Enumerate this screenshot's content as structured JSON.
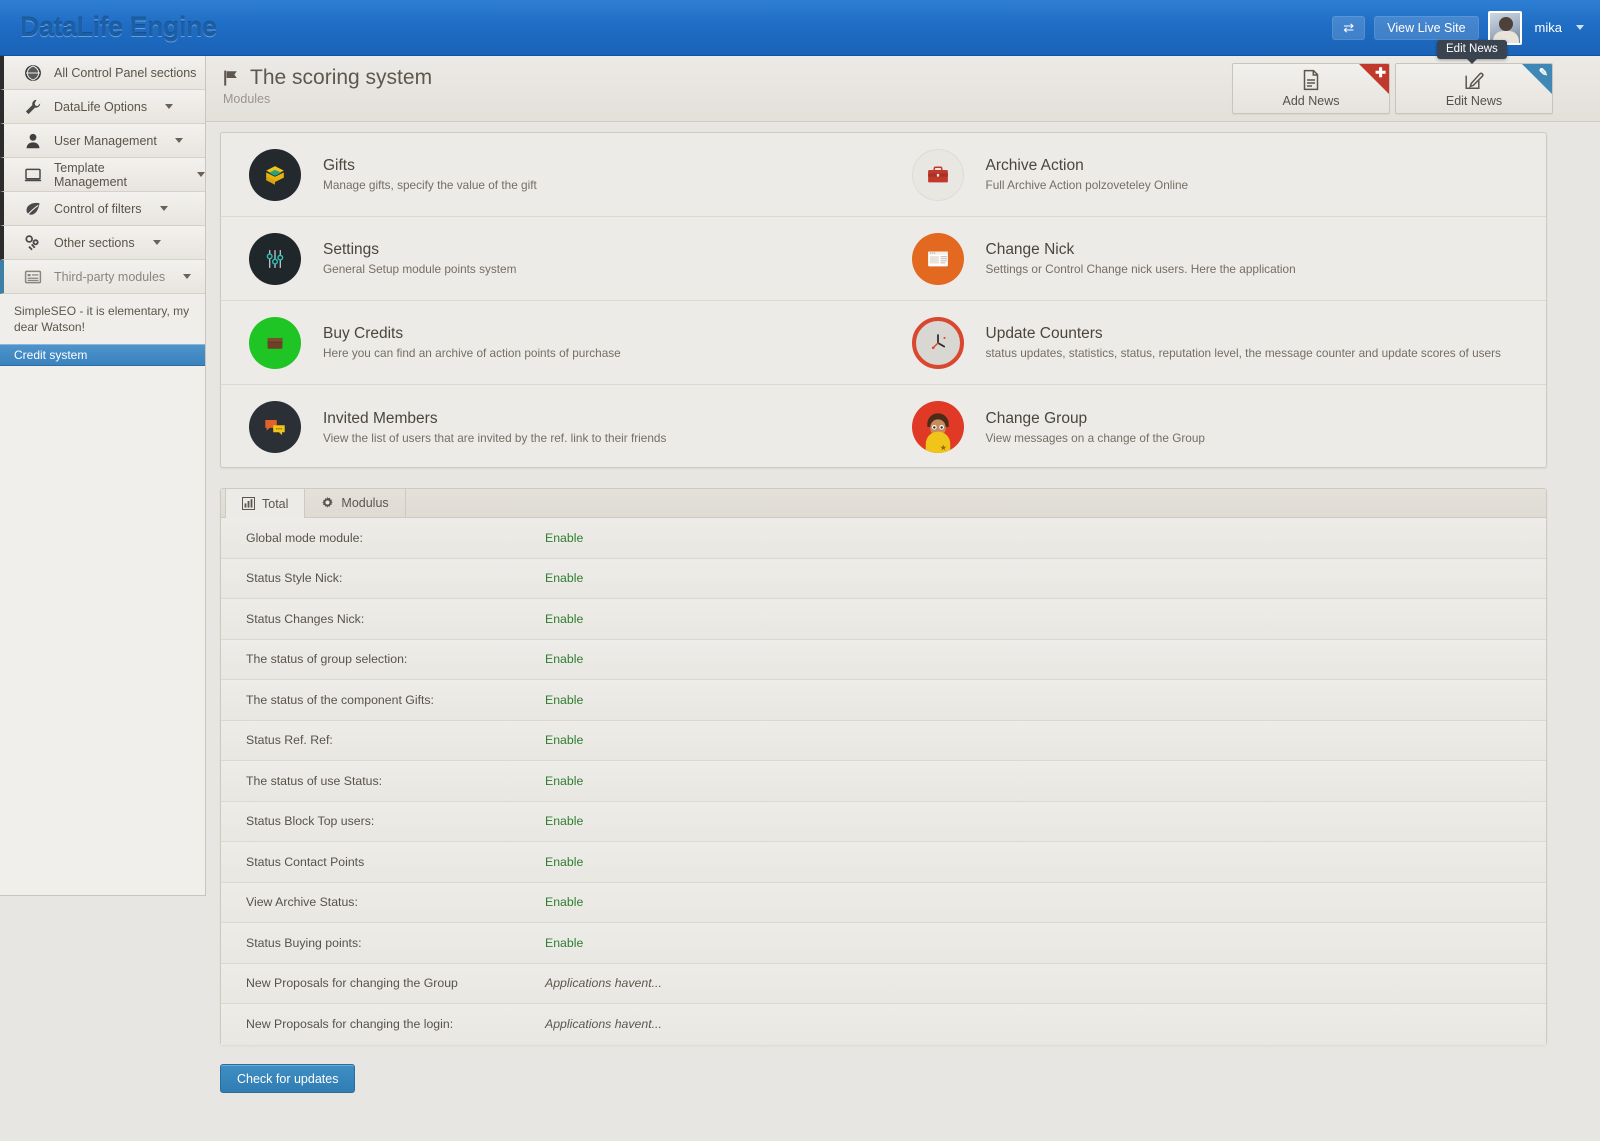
{
  "topbar": {
    "brand": "DataLife Engine",
    "swap_icon": "swap-arrows-icon",
    "view_live_site": "View Live Site",
    "username": "mika",
    "tooltip": "Edit News"
  },
  "sidebar": {
    "items": [
      {
        "label": "All Control Panel sections",
        "icon": "globe-icon",
        "caret": false
      },
      {
        "label": "DataLife Options",
        "icon": "wrench-icon",
        "caret": true
      },
      {
        "label": "User Management",
        "icon": "user-icon",
        "caret": true
      },
      {
        "label": "Template Management",
        "icon": "monitor-icon",
        "caret": true
      },
      {
        "label": "Control of filters",
        "icon": "leaf-icon",
        "caret": true
      },
      {
        "label": "Other sections",
        "icon": "link-icon",
        "caret": true
      },
      {
        "label": "Third-party modules",
        "icon": "list-icon",
        "caret": true
      }
    ],
    "note": "SimpleSEO - it is elementary, my dear Watson!",
    "selected": "Credit system"
  },
  "page": {
    "title": "The scoring system",
    "subtitle": "Modules",
    "title_icon": "flag-icon",
    "actions": [
      {
        "label": "Add News",
        "icon": "document-icon",
        "ribbon": "plus",
        "ribbon_color": "#c0392b"
      },
      {
        "label": "Edit News",
        "icon": "edit-pencil-icon",
        "ribbon": "pencil",
        "ribbon_color": "#3f87b5"
      }
    ]
  },
  "modules": [
    {
      "title": "Gifts",
      "desc": "Manage gifts, specify the value of the gift",
      "icon": "gift-box-icon",
      "bg": "#23292c"
    },
    {
      "title": "Archive Action",
      "desc": "Full Archive Action polzoveteley Online",
      "icon": "briefcase-icon",
      "bg": "#e9e7e2"
    },
    {
      "title": "Settings",
      "desc": "General Setup module points system",
      "icon": "sliders-icon",
      "bg": "#1f272b"
    },
    {
      "title": "Change Nick",
      "desc": "Settings or Control Change nick users. Here the application",
      "icon": "browser-window-icon",
      "bg": "#e2691f"
    },
    {
      "title": "Buy Credits",
      "desc": "Here you can find an archive of action points of purchase",
      "icon": "wallet-icon",
      "bg": "#1fc425"
    },
    {
      "title": "Update Counters",
      "desc": "status updates, statistics, status, reputation level, the message counter and update scores of users",
      "icon": "clock-icon",
      "bg": "#d9d7d2"
    },
    {
      "title": "Invited Members",
      "desc": "View the list of users that are invited by the ref. link to their friends",
      "icon": "chat-bubbles-icon",
      "bg": "#2a3035"
    },
    {
      "title": "Change Group",
      "desc": "View messages on a change of the Group",
      "icon": "person-avatar-icon",
      "bg": "#e03a26"
    }
  ],
  "tabs": [
    {
      "label": "Total",
      "icon": "bar-chart-icon",
      "active": true
    },
    {
      "label": "Modulus",
      "icon": "gear-icon",
      "active": false
    }
  ],
  "table": {
    "rows": [
      {
        "label": "Global mode module:",
        "value": "Enable",
        "muted": false
      },
      {
        "label": "Status Style Nick:",
        "value": "Enable",
        "muted": false
      },
      {
        "label": "Status Changes Nick:",
        "value": "Enable",
        "muted": false
      },
      {
        "label": "The status of group selection:",
        "value": "Enable",
        "muted": false
      },
      {
        "label": "The status of the component Gifts:",
        "value": "Enable",
        "muted": false
      },
      {
        "label": "Status Ref. Ref:",
        "value": "Enable",
        "muted": false
      },
      {
        "label": "The status of use Status:",
        "value": "Enable",
        "muted": false
      },
      {
        "label": "Status Block Top users:",
        "value": "Enable",
        "muted": false
      },
      {
        "label": "Status Contact Points",
        "value": "Enable",
        "muted": false
      },
      {
        "label": "View Archive Status:",
        "value": "Enable",
        "muted": false
      },
      {
        "label": "Status Buying points:",
        "value": "Enable",
        "muted": false
      },
      {
        "label": "New Proposals for changing the Group",
        "value": "Applications havent...",
        "muted": true
      },
      {
        "label": "New Proposals for changing the login:",
        "value": "Applications havent...",
        "muted": true
      }
    ]
  },
  "footer": {
    "check_updates": "Check for updates"
  },
  "colors": {
    "brand_blue": "#1f6dc4",
    "enable_green": "#2f7d32",
    "selected_blue": "#3a82bd",
    "ribbon_red": "#c0392b",
    "ribbon_blue": "#3f87b5"
  }
}
